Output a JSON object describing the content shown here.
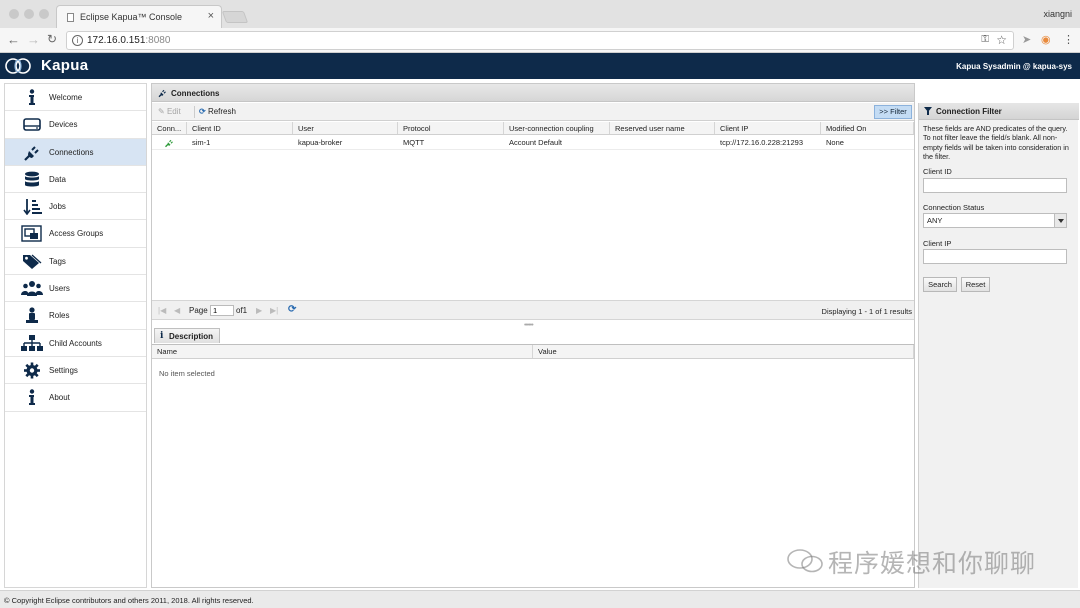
{
  "browser": {
    "tab_title": "Eclipse Kapua™ Console",
    "tab_close": "×",
    "profile_name": "xiangni",
    "url_host": "172.16.0.151",
    "url_port": ":8080"
  },
  "header": {
    "brand": "Kapua",
    "user": "Kapua Sysadmin @ kapua-sys"
  },
  "sidebar": {
    "items": [
      {
        "label": "Welcome",
        "icon": "info-icon"
      },
      {
        "label": "Devices",
        "icon": "device-icon"
      },
      {
        "label": "Connections",
        "icon": "plug-icon"
      },
      {
        "label": "Data",
        "icon": "database-icon"
      },
      {
        "label": "Jobs",
        "icon": "jobs-icon"
      },
      {
        "label": "Access Groups",
        "icon": "access-groups-icon"
      },
      {
        "label": "Tags",
        "icon": "tags-icon"
      },
      {
        "label": "Users",
        "icon": "users-icon"
      },
      {
        "label": "Roles",
        "icon": "roles-icon"
      },
      {
        "label": "Child Accounts",
        "icon": "hierarchy-icon"
      },
      {
        "label": "Settings",
        "icon": "gear-icon"
      },
      {
        "label": "About",
        "icon": "info-icon"
      }
    ],
    "active_index": 2
  },
  "main": {
    "title": "Connections",
    "toolbar": {
      "edit_label": "Edit",
      "refresh_label": "Refresh",
      "filter_label": ">> Filter"
    },
    "columns": [
      "Conn...",
      "Client ID",
      "User",
      "Protocol",
      "User-connection coupling",
      "Reserved user name",
      "Client IP",
      "Modified On"
    ],
    "rows": [
      {
        "status": "connected",
        "client_id": "sim-1",
        "user": "kapua-broker",
        "protocol": "MQTT",
        "coupling": "Account Default",
        "reserved": "",
        "client_ip": "tcp://172.16.0.228:21293",
        "modified_on": "None"
      }
    ],
    "pager": {
      "page_label": "Page",
      "page_value": "1",
      "of_label": "of1",
      "displaying": "Displaying 1 - 1 of 1 results"
    },
    "description": {
      "tab_label": "Description",
      "columns": [
        "Name",
        "Value"
      ],
      "empty_text": "No item selected"
    }
  },
  "filter": {
    "title": "Connection Filter",
    "description": "These fields are AND predicates of the query. To not filter leave the field/s blank. All non-empty fields will be taken into consideration in the filter.",
    "client_id_label": "Client ID",
    "client_id_value": "",
    "status_label": "Connection Status",
    "status_value": "ANY",
    "client_ip_label": "Client IP",
    "client_ip_value": "",
    "search_label": "Search",
    "reset_label": "Reset"
  },
  "footer": {
    "copyright": "© Copyright Eclipse contributors and others 2011, 2018. All rights reserved."
  },
  "watermark": "程序媛想和你聊聊",
  "colors": {
    "header_bg": "#0e2a4a",
    "active_item": "#d7e4f3",
    "filter_button": "#c4dcf4",
    "connected_icon": "#2e9b3a"
  }
}
